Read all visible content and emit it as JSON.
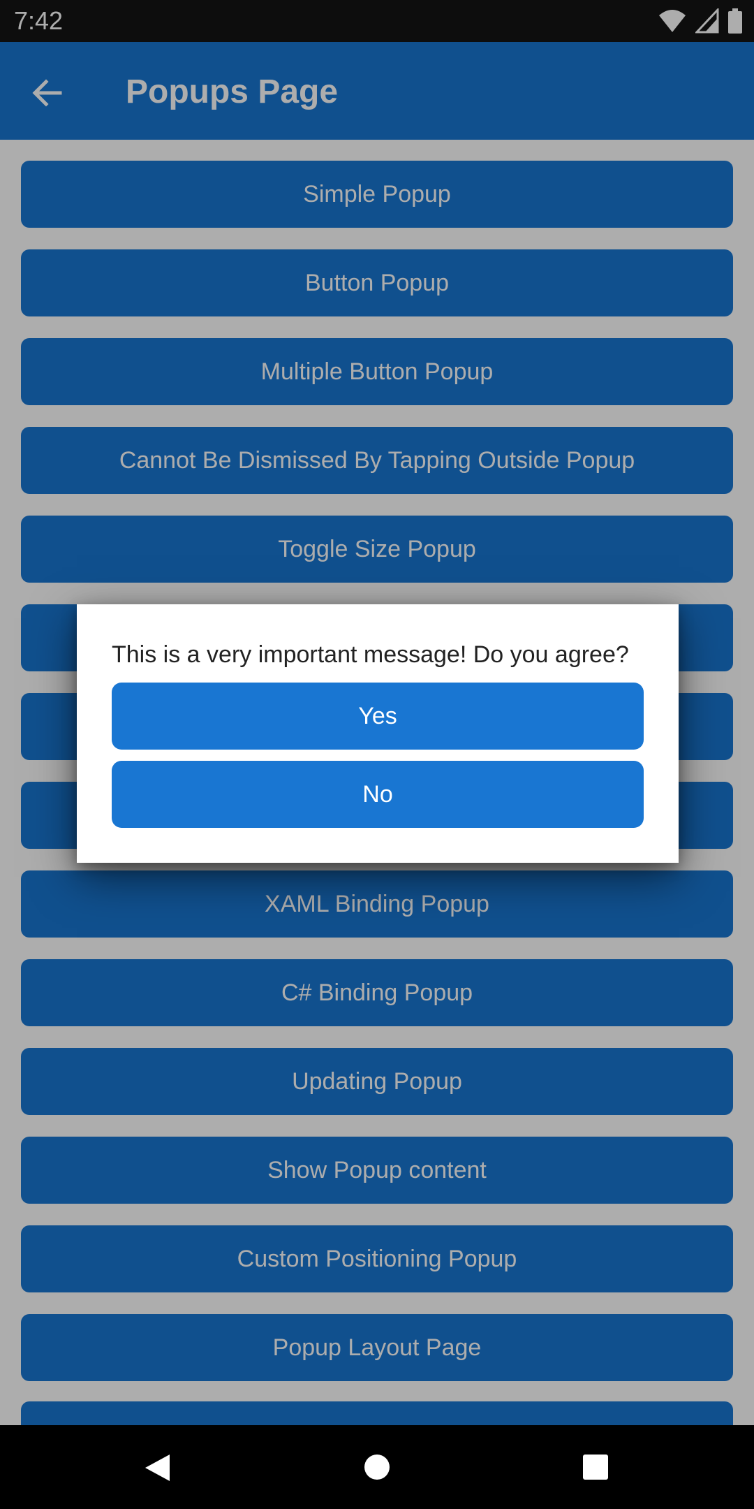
{
  "status_bar": {
    "time": "7:42",
    "icons": [
      "wifi-icon",
      "signal-icon",
      "battery-icon"
    ]
  },
  "app_bar": {
    "title": "Popups Page",
    "back_icon": "arrow-back-icon"
  },
  "buttons": [
    "Simple Popup",
    "Button Popup",
    "Multiple Button Popup",
    "Cannot Be Dismissed By Tapping Outside Popup",
    "Toggle Size Popup",
    "",
    "",
    "",
    "XAML Binding Popup",
    "C# Binding Popup",
    "Updating Popup",
    "Show Popup content",
    "Custom Positioning Popup",
    "Popup Layout Page"
  ],
  "dialog": {
    "message": "This is a very important message! Do you agree?",
    "yes_label": "Yes",
    "no_label": "No"
  },
  "nav_bar": {
    "icons": [
      "back-triangle-icon",
      "home-circle-icon",
      "recents-square-icon"
    ]
  },
  "colors": {
    "primary": "#1976d2",
    "scrim": "rgba(0,0,0,0.32)",
    "status_bar": "#141414"
  }
}
